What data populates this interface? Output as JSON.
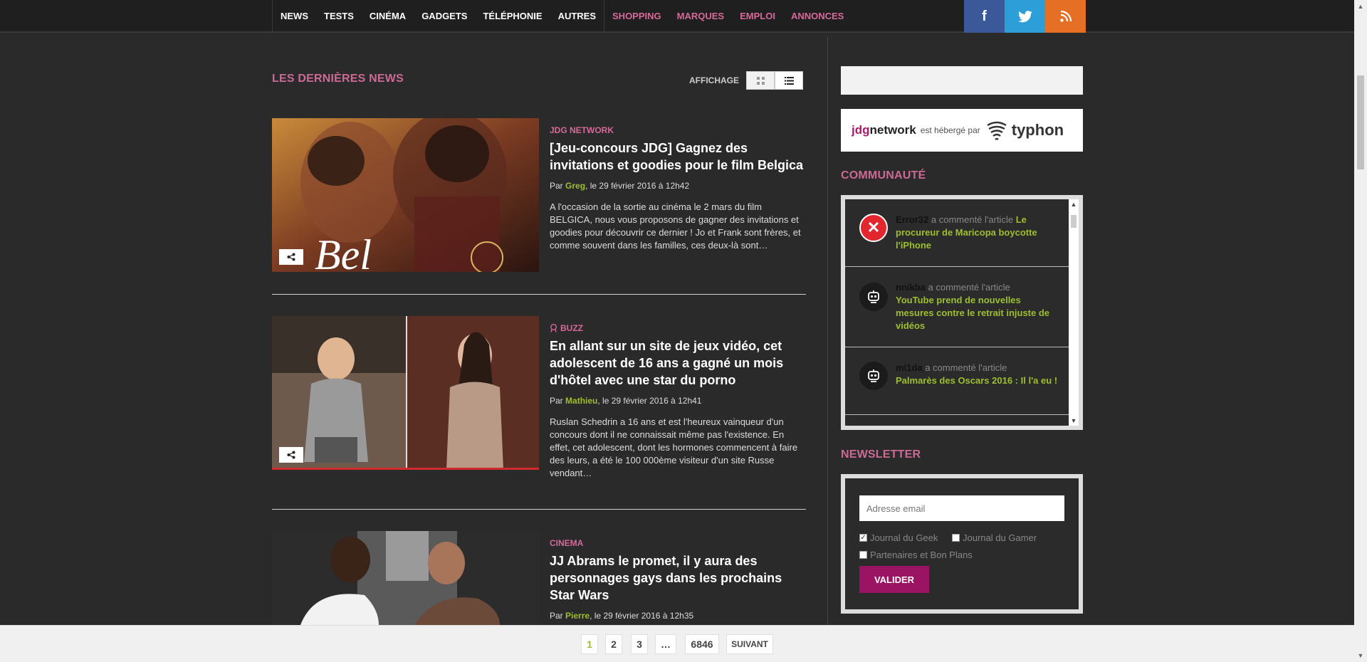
{
  "nav": {
    "items": [
      "NEWS",
      "TESTS",
      "CINÉMA",
      "GADGETS",
      "TÉLÉPHONIE",
      "AUTRES"
    ],
    "pink_items": [
      "SHOPPING",
      "MARQUES",
      "EMPLOI",
      "ANNONCES"
    ],
    "social": {
      "facebook": "f",
      "twitter": "t",
      "rss": "rss"
    }
  },
  "main": {
    "section_title": "LES DERNIÈRES NEWS",
    "affichage_label": "AFFICHAGE",
    "articles": [
      {
        "category": "JDG NETWORK",
        "title": "[Jeu-concours JDG] Gagnez des invitations et goodies pour le film Belgica",
        "by": "Par",
        "author": "Greg",
        "date": ", le 29 février 2016 à 12h42",
        "excerpt": "A l'occasion de la sortie au cinéma le 2 mars du film BELGICA, nous vous proposons de gagner des invitations et goodies pour découvrir ce dernier ! Jo et Frank sont frères, et comme souvent dans les familles, ces deux-là sont…"
      },
      {
        "category": "BUZZ",
        "title": "En allant sur un site de jeux vidéo, cet adolescent de 16 ans a gagné un mois d'hôtel avec une star du porno",
        "by": "Par",
        "author": "Mathieu",
        "date": ", le 29 février 2016 à 12h41",
        "excerpt": "Ruslan Schedrin a 16 ans et est l'heureux vainqueur d'un concours dont il ne connaissait même pas l'existence. En effet, cet adolescent, dont les hormones commencent à faire des leurs, a été le 100 000ème visiteur d'un site Russe vendant…"
      },
      {
        "category": "CINEMA",
        "title": "JJ Abrams le promet, il y aura des personnages gays dans les prochains Star Wars",
        "by": "Par",
        "author": "Pierre",
        "date": ", le 29 février 2016 à 12h35",
        "excerpt": ""
      }
    ]
  },
  "sidebar": {
    "host": {
      "brand_a": "jdg",
      "brand_b": "network",
      "text": "est hébergé par",
      "partner": "typhon"
    },
    "community_title": "COMMUNAUTÉ",
    "comments": [
      {
        "user": "Error32",
        "action": "a commenté l'article",
        "article": "Le procureur de Maricopa boycotte l'iPhone"
      },
      {
        "user": "nnikba",
        "action": "a commenté l'article",
        "article": "YouTube prend de nouvelles mesures contre le retrait injuste de vidéos"
      },
      {
        "user": "mi1da",
        "action": "a commenté l'article",
        "article": "Palmarès des Oscars 2016 : Il l'a eu !"
      }
    ],
    "newsletter_title": "NEWSLETTER",
    "newsletter": {
      "email_placeholder": "Adresse email",
      "opt1": "Journal du Geek",
      "opt2": "Journal du Gamer",
      "opt3": "Partenaires et Bon Plans",
      "submit": "VALIDER"
    }
  },
  "pagination": {
    "pages": [
      "1",
      "2",
      "3",
      "…",
      "6846"
    ],
    "next": "SUIVANT"
  },
  "colors": {
    "accent_pink": "#cc6a95",
    "author_green": "#9dbf2f",
    "button_purple": "#9b1463"
  }
}
